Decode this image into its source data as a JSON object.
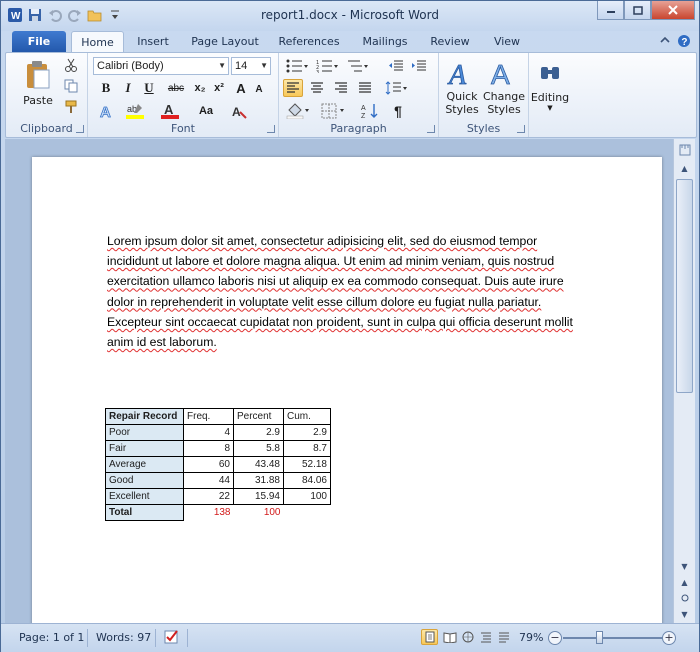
{
  "window": {
    "title": "report1.docx - Microsoft Word"
  },
  "quick_access": {
    "app_icon": "word-icon",
    "save_icon": "save-icon",
    "undo_icon": "undo-icon",
    "redo_icon": "redo-icon",
    "open_icon": "open-folder-icon",
    "customize_icon": "customize-qat-icon"
  },
  "tabs": [
    {
      "label": "File"
    },
    {
      "label": "Home"
    },
    {
      "label": "Insert"
    },
    {
      "label": "Page Layout"
    },
    {
      "label": "References"
    },
    {
      "label": "Mailings"
    },
    {
      "label": "Review"
    },
    {
      "label": "View"
    }
  ],
  "ribbon": {
    "clipboard": {
      "group_label": "Clipboard",
      "paste_label": "Paste"
    },
    "font": {
      "group_label": "Font",
      "font_name": "Calibri (Body)",
      "font_size": "14",
      "bold": "B",
      "italic": "I",
      "underline": "U",
      "strikethrough": "abc",
      "subscript": "x₂",
      "superscript": "x²",
      "change_case": "Aa",
      "grow": "A",
      "shrink": "A"
    },
    "paragraph": {
      "group_label": "Paragraph",
      "pilcrow": "¶"
    },
    "styles": {
      "group_label": "Styles",
      "quick_styles_label": "Quick\nStyles",
      "quick_styles_line1": "Quick",
      "quick_styles_line2": "Styles",
      "change_styles_line1": "Change",
      "change_styles_line2": "Styles"
    },
    "editing": {
      "label": "Editing"
    }
  },
  "document": {
    "paragraph": "Lorem ipsum dolor sit amet, consectetur adipisicing elit, sed do eiusmod tempor incididunt ut labore et dolore magna aliqua. Ut enim ad minim veniam, quis nostrud exercitation ullamco laboris nisi ut aliquip ex ea commodo consequat. Duis aute irure dolor in reprehenderit in voluptate velit esse cillum dolore eu fugiat nulla pariatur. Excepteur sint occaecat cupidatat non proident, sunt in culpa qui officia deserunt mollit anim id est laborum.",
    "table": {
      "headers": [
        "Repair Record",
        "Freq.",
        "Percent",
        "Cum."
      ],
      "rows": [
        [
          "Poor",
          "4",
          "2.9",
          "2.9"
        ],
        [
          "Fair",
          "8",
          "5.8",
          "8.7"
        ],
        [
          "Average",
          "60",
          "43.48",
          "52.18"
        ],
        [
          "Good",
          "44",
          "31.88",
          "84.06"
        ],
        [
          "Excellent",
          "22",
          "15.94",
          "100"
        ]
      ],
      "total": [
        "Total",
        "138",
        "100"
      ],
      "total_color": "#d21a1a"
    }
  },
  "statusbar": {
    "page": "Page: 1 of 1",
    "words": "Words: 97",
    "zoom": "79%",
    "zoom_out": "−",
    "zoom_in": "+"
  },
  "colors": {
    "file_tab": "#2a62b8",
    "ribbon_bg": "#e3ebf6",
    "doc_bg": "#abc0dc",
    "table_header_bg": "#dbe9f3"
  }
}
